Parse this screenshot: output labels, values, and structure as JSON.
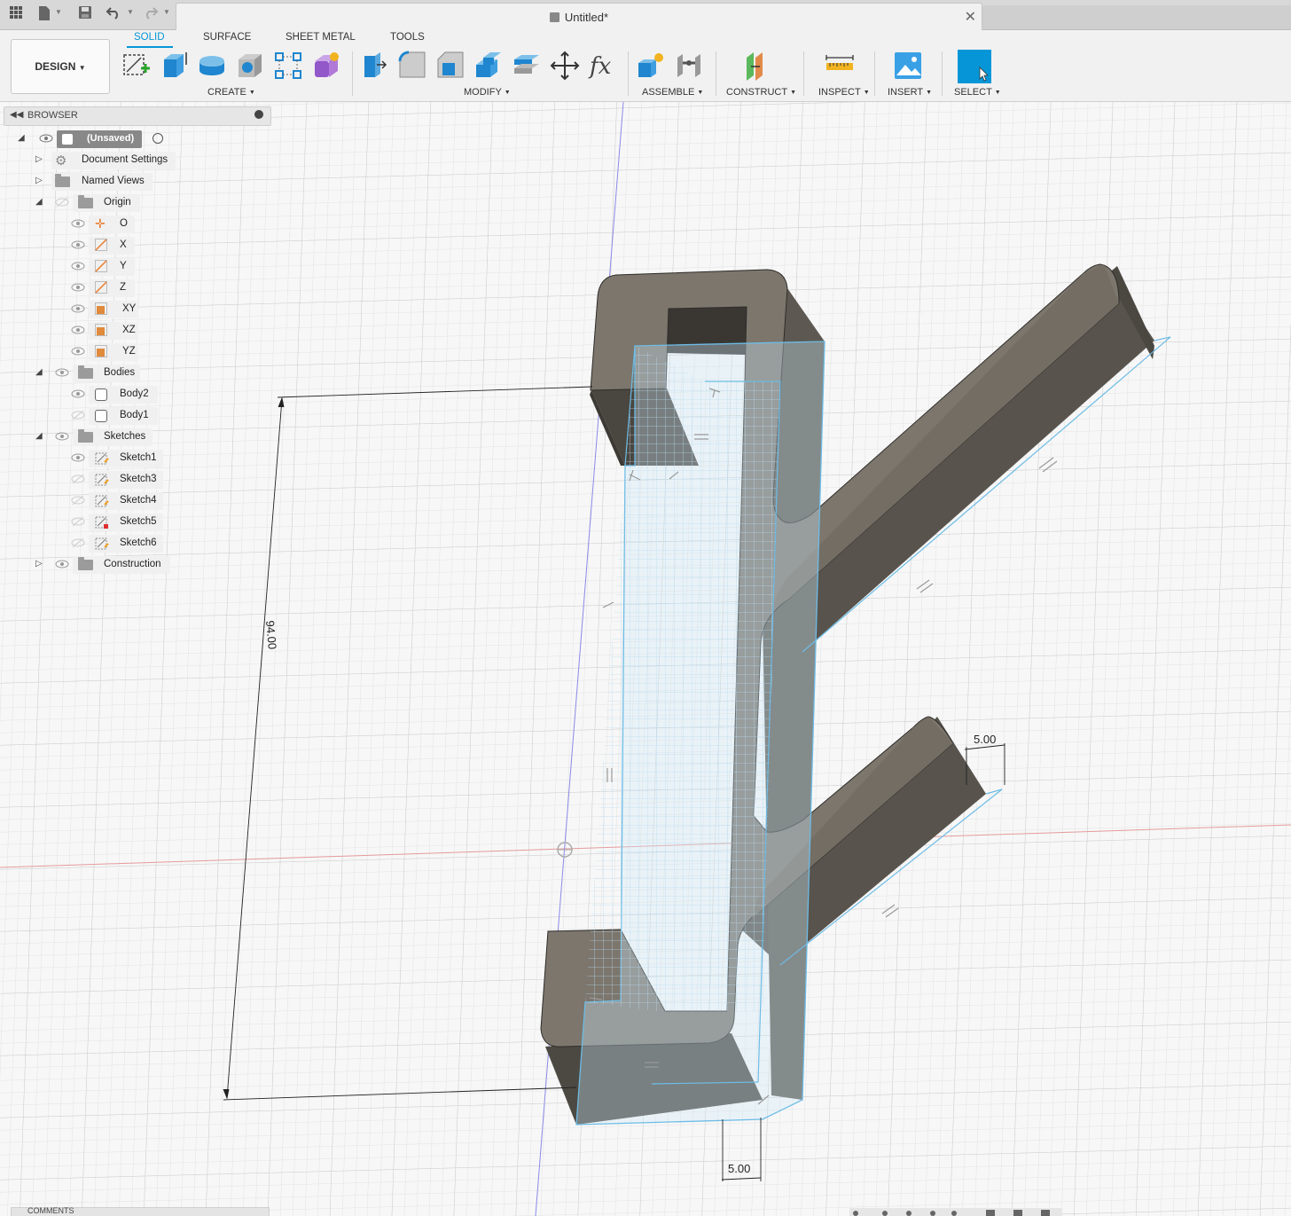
{
  "app": {
    "document_title": "Untitled*",
    "workspace_button": "DESIGN"
  },
  "tabs": {
    "solid": "SOLID",
    "surface": "SURFACE",
    "sheet_metal": "SHEET METAL",
    "tools": "TOOLS"
  },
  "groups": {
    "create": "CREATE",
    "modify": "MODIFY",
    "assemble": "ASSEMBLE",
    "construct": "CONSTRUCT",
    "inspect": "INSPECT",
    "insert": "INSERT",
    "select": "SELECT"
  },
  "browser": {
    "title": "BROWSER",
    "root": "(Unsaved)",
    "items": {
      "document_settings": "Document Settings",
      "named_views": "Named Views",
      "origin": "Origin",
      "o": "O",
      "x": "X",
      "y": "Y",
      "z": "Z",
      "xy": "XY",
      "xz": "XZ",
      "yz": "YZ",
      "bodies": "Bodies",
      "body2": "Body2",
      "body1": "Body1",
      "sketches": "Sketches",
      "sketch1": "Sketch1",
      "sketch3": "Sketch3",
      "sketch4": "Sketch4",
      "sketch5": "Sketch5",
      "sketch6": "Sketch6",
      "construction": "Construction"
    }
  },
  "dimensions": {
    "height": "94.00",
    "width_top": "5.00",
    "width_bottom": "5.00"
  },
  "comments_label": "COMMENTS",
  "colors": {
    "accent": "#0696d7",
    "body_front": "#7d776e",
    "body_side": "#5e5a53",
    "sketch_profile": "#d6ecf8"
  }
}
